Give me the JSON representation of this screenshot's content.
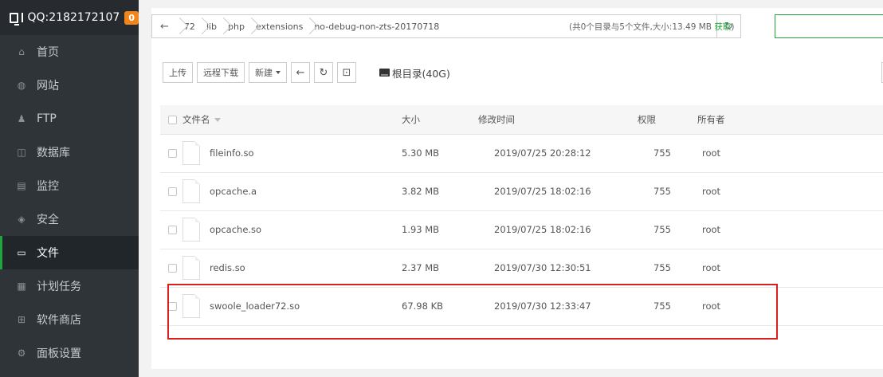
{
  "sidebar": {
    "brand": "QQ:2182172107",
    "badge": "0",
    "items": [
      {
        "label": "首页",
        "icon": "home-icon",
        "glyph": "⌂"
      },
      {
        "label": "网站",
        "icon": "globe-icon",
        "glyph": "◍"
      },
      {
        "label": "FTP",
        "icon": "user-icon",
        "glyph": "♟"
      },
      {
        "label": "数据库",
        "icon": "database-icon",
        "glyph": "◫"
      },
      {
        "label": "监控",
        "icon": "monitor-icon",
        "glyph": "▤"
      },
      {
        "label": "安全",
        "icon": "shield-icon",
        "glyph": "◈"
      },
      {
        "label": "文件",
        "icon": "folder-icon",
        "glyph": "▭"
      },
      {
        "label": "计划任务",
        "icon": "calendar-icon",
        "glyph": "▦"
      },
      {
        "label": "软件商店",
        "icon": "apps-icon",
        "glyph": "⊞"
      },
      {
        "label": "面板设置",
        "icon": "gear-icon",
        "glyph": "⚙"
      }
    ]
  },
  "path": {
    "back": "←",
    "crumbs": [
      "72",
      "lib",
      "php",
      "extensions",
      "no-debug-non-zts-20170718"
    ],
    "refresh": "↻",
    "info": "(共0个目录与5个文件,大小:13.49 MB ",
    "get": "获取",
    "info_end": ")"
  },
  "toolbar": {
    "upload": "上传",
    "remote_download": "远程下载",
    "new": "新建",
    "back": "←",
    "refresh": "↻",
    "terminal": "⊡",
    "disk": "根目录(40G)"
  },
  "table": {
    "headers": {
      "name": "文件名",
      "size": "大小",
      "mtime": "修改时间",
      "perm": "权限",
      "owner": "所有者"
    },
    "rows": [
      {
        "name": "fileinfo.so",
        "size": "5.30 MB",
        "mtime": "2019/07/25 20:28:12",
        "perm": "755",
        "owner": "root"
      },
      {
        "name": "opcache.a",
        "size": "3.82 MB",
        "mtime": "2019/07/25 18:02:16",
        "perm": "755",
        "owner": "root"
      },
      {
        "name": "opcache.so",
        "size": "1.93 MB",
        "mtime": "2019/07/25 18:02:16",
        "perm": "755",
        "owner": "root"
      },
      {
        "name": "redis.so",
        "size": "2.37 MB",
        "mtime": "2019/07/30 12:30:51",
        "perm": "755",
        "owner": "root"
      },
      {
        "name": "swoole_loader72.so",
        "size": "67.98 KB",
        "mtime": "2019/07/30 12:33:47",
        "perm": "755",
        "owner": "root"
      }
    ]
  },
  "colors": {
    "accent": "#20a53a",
    "highlight": "#d9201e",
    "sidebar": "#2f3438",
    "badge": "#f0851e"
  }
}
